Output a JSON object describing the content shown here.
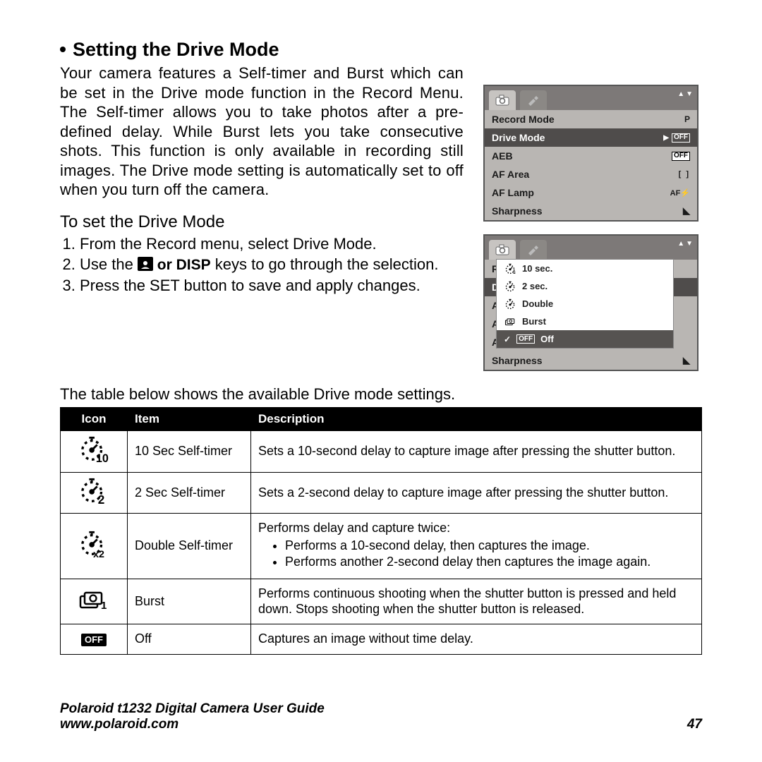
{
  "heading": "Setting the Drive Mode",
  "intro": "Your camera features a Self-timer and Burst which can be set in the Drive mode function in the Record Menu. The Self-timer allows you to take photos after a pre-defined delay. While Burst lets you take consecutive shots. This function is only available in recording still images. The Drive mode setting is automatically set to off when you turn off the camera.",
  "subheading": "To set the Drive Mode",
  "steps": {
    "s1": "From the Record menu, select Drive Mode.",
    "s2a": "Use the ",
    "s2b": " or DISP",
    "s2c": " keys to go through the selection.",
    "s3": "Press the SET button to save and apply changes."
  },
  "table_intro": "The table below shows the available Drive mode settings.",
  "lcd1": {
    "rows": [
      {
        "label": "Record Mode",
        "value": "P",
        "valueType": "bigP"
      },
      {
        "label": "Drive Mode",
        "value": "OFF",
        "hi": true,
        "arrow": true
      },
      {
        "label": "AEB",
        "value": "OFF"
      },
      {
        "label": "AF Area",
        "value": "[ ]"
      },
      {
        "label": "AF Lamp",
        "value": "AF⚡"
      },
      {
        "label": "Sharpness",
        "value": "◣"
      }
    ]
  },
  "lcd2": {
    "bg_rows": [
      "R",
      "D",
      "A",
      "A",
      "A",
      "Sharpness"
    ],
    "popup": [
      {
        "icon": "timer10",
        "label": "10 sec."
      },
      {
        "icon": "timer2",
        "label": "2 sec."
      },
      {
        "icon": "double",
        "label": "Double"
      },
      {
        "icon": "burst",
        "label": "Burst"
      },
      {
        "icon": "off",
        "label": "Off",
        "selected": true
      }
    ]
  },
  "table": {
    "headers": [
      "Icon",
      "Item",
      "Description"
    ],
    "rows": [
      {
        "icon": "timer10",
        "item": "10 Sec Self-timer",
        "desc": "Sets a 10-second delay to capture image after pressing the shutter button."
      },
      {
        "icon": "timer2",
        "item": "2 Sec Self-timer",
        "desc": "Sets a 2-second delay to capture image after pressing the shutter button."
      },
      {
        "icon": "double",
        "item": "Double Self-timer",
        "desc_intro": "Performs delay and capture twice:",
        "desc_list": [
          "Performs a 10-second delay, then captures the image.",
          "Performs another 2-second delay then captures the image again."
        ]
      },
      {
        "icon": "burst",
        "item": "Burst",
        "desc": "Performs continuous shooting when the shutter button is pressed and held down. Stops shooting when the shutter button is released."
      },
      {
        "icon": "off",
        "item": "Off",
        "desc": "Captures an image without time delay."
      }
    ]
  },
  "footer": {
    "guide": "Polaroid t1232 Digital Camera User Guide",
    "url": "www.polaroid.com",
    "page": "47"
  }
}
